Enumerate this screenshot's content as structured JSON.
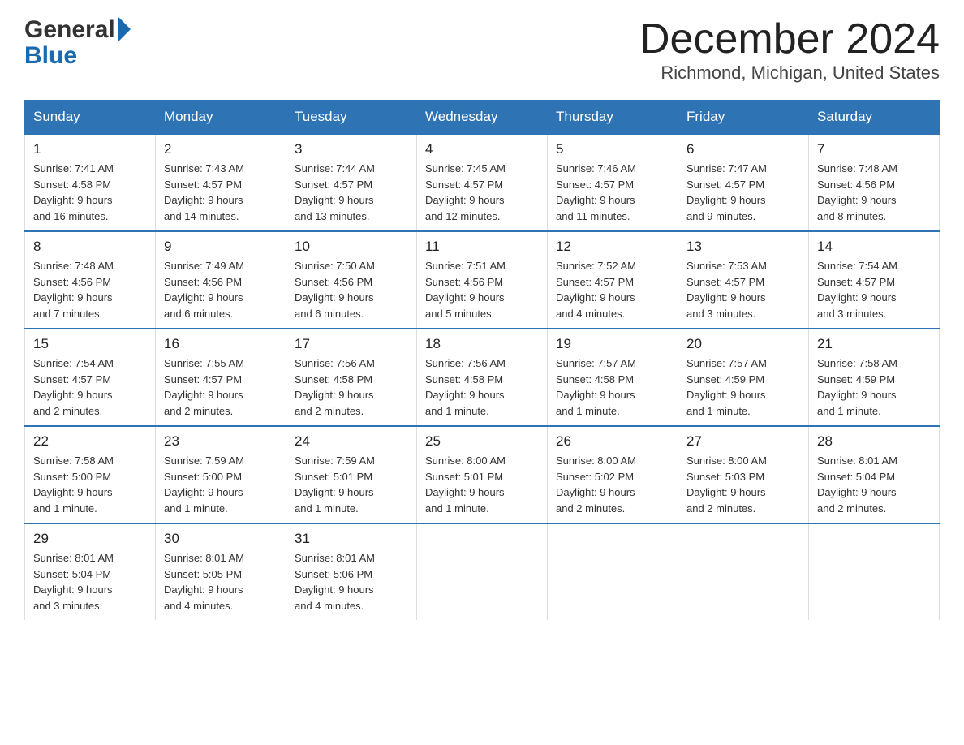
{
  "header": {
    "logo_general": "General",
    "logo_blue": "Blue",
    "month_title": "December 2024",
    "location": "Richmond, Michigan, United States"
  },
  "days_of_week": [
    "Sunday",
    "Monday",
    "Tuesday",
    "Wednesday",
    "Thursday",
    "Friday",
    "Saturday"
  ],
  "weeks": [
    [
      {
        "day": "1",
        "sunrise": "7:41 AM",
        "sunset": "4:58 PM",
        "daylight": "9 hours and 16 minutes."
      },
      {
        "day": "2",
        "sunrise": "7:43 AM",
        "sunset": "4:57 PM",
        "daylight": "9 hours and 14 minutes."
      },
      {
        "day": "3",
        "sunrise": "7:44 AM",
        "sunset": "4:57 PM",
        "daylight": "9 hours and 13 minutes."
      },
      {
        "day": "4",
        "sunrise": "7:45 AM",
        "sunset": "4:57 PM",
        "daylight": "9 hours and 12 minutes."
      },
      {
        "day": "5",
        "sunrise": "7:46 AM",
        "sunset": "4:57 PM",
        "daylight": "9 hours and 11 minutes."
      },
      {
        "day": "6",
        "sunrise": "7:47 AM",
        "sunset": "4:57 PM",
        "daylight": "9 hours and 9 minutes."
      },
      {
        "day": "7",
        "sunrise": "7:48 AM",
        "sunset": "4:56 PM",
        "daylight": "9 hours and 8 minutes."
      }
    ],
    [
      {
        "day": "8",
        "sunrise": "7:48 AM",
        "sunset": "4:56 PM",
        "daylight": "9 hours and 7 minutes."
      },
      {
        "day": "9",
        "sunrise": "7:49 AM",
        "sunset": "4:56 PM",
        "daylight": "9 hours and 6 minutes."
      },
      {
        "day": "10",
        "sunrise": "7:50 AM",
        "sunset": "4:56 PM",
        "daylight": "9 hours and 6 minutes."
      },
      {
        "day": "11",
        "sunrise": "7:51 AM",
        "sunset": "4:56 PM",
        "daylight": "9 hours and 5 minutes."
      },
      {
        "day": "12",
        "sunrise": "7:52 AM",
        "sunset": "4:57 PM",
        "daylight": "9 hours and 4 minutes."
      },
      {
        "day": "13",
        "sunrise": "7:53 AM",
        "sunset": "4:57 PM",
        "daylight": "9 hours and 3 minutes."
      },
      {
        "day": "14",
        "sunrise": "7:54 AM",
        "sunset": "4:57 PM",
        "daylight": "9 hours and 3 minutes."
      }
    ],
    [
      {
        "day": "15",
        "sunrise": "7:54 AM",
        "sunset": "4:57 PM",
        "daylight": "9 hours and 2 minutes."
      },
      {
        "day": "16",
        "sunrise": "7:55 AM",
        "sunset": "4:57 PM",
        "daylight": "9 hours and 2 minutes."
      },
      {
        "day": "17",
        "sunrise": "7:56 AM",
        "sunset": "4:58 PM",
        "daylight": "9 hours and 2 minutes."
      },
      {
        "day": "18",
        "sunrise": "7:56 AM",
        "sunset": "4:58 PM",
        "daylight": "9 hours and 1 minute."
      },
      {
        "day": "19",
        "sunrise": "7:57 AM",
        "sunset": "4:58 PM",
        "daylight": "9 hours and 1 minute."
      },
      {
        "day": "20",
        "sunrise": "7:57 AM",
        "sunset": "4:59 PM",
        "daylight": "9 hours and 1 minute."
      },
      {
        "day": "21",
        "sunrise": "7:58 AM",
        "sunset": "4:59 PM",
        "daylight": "9 hours and 1 minute."
      }
    ],
    [
      {
        "day": "22",
        "sunrise": "7:58 AM",
        "sunset": "5:00 PM",
        "daylight": "9 hours and 1 minute."
      },
      {
        "day": "23",
        "sunrise": "7:59 AM",
        "sunset": "5:00 PM",
        "daylight": "9 hours and 1 minute."
      },
      {
        "day": "24",
        "sunrise": "7:59 AM",
        "sunset": "5:01 PM",
        "daylight": "9 hours and 1 minute."
      },
      {
        "day": "25",
        "sunrise": "8:00 AM",
        "sunset": "5:01 PM",
        "daylight": "9 hours and 1 minute."
      },
      {
        "day": "26",
        "sunrise": "8:00 AM",
        "sunset": "5:02 PM",
        "daylight": "9 hours and 2 minutes."
      },
      {
        "day": "27",
        "sunrise": "8:00 AM",
        "sunset": "5:03 PM",
        "daylight": "9 hours and 2 minutes."
      },
      {
        "day": "28",
        "sunrise": "8:01 AM",
        "sunset": "5:04 PM",
        "daylight": "9 hours and 2 minutes."
      }
    ],
    [
      {
        "day": "29",
        "sunrise": "8:01 AM",
        "sunset": "5:04 PM",
        "daylight": "9 hours and 3 minutes."
      },
      {
        "day": "30",
        "sunrise": "8:01 AM",
        "sunset": "5:05 PM",
        "daylight": "9 hours and 4 minutes."
      },
      {
        "day": "31",
        "sunrise": "8:01 AM",
        "sunset": "5:06 PM",
        "daylight": "9 hours and 4 minutes."
      },
      null,
      null,
      null,
      null
    ]
  ],
  "labels": {
    "sunrise": "Sunrise:",
    "sunset": "Sunset:",
    "daylight": "Daylight:"
  }
}
